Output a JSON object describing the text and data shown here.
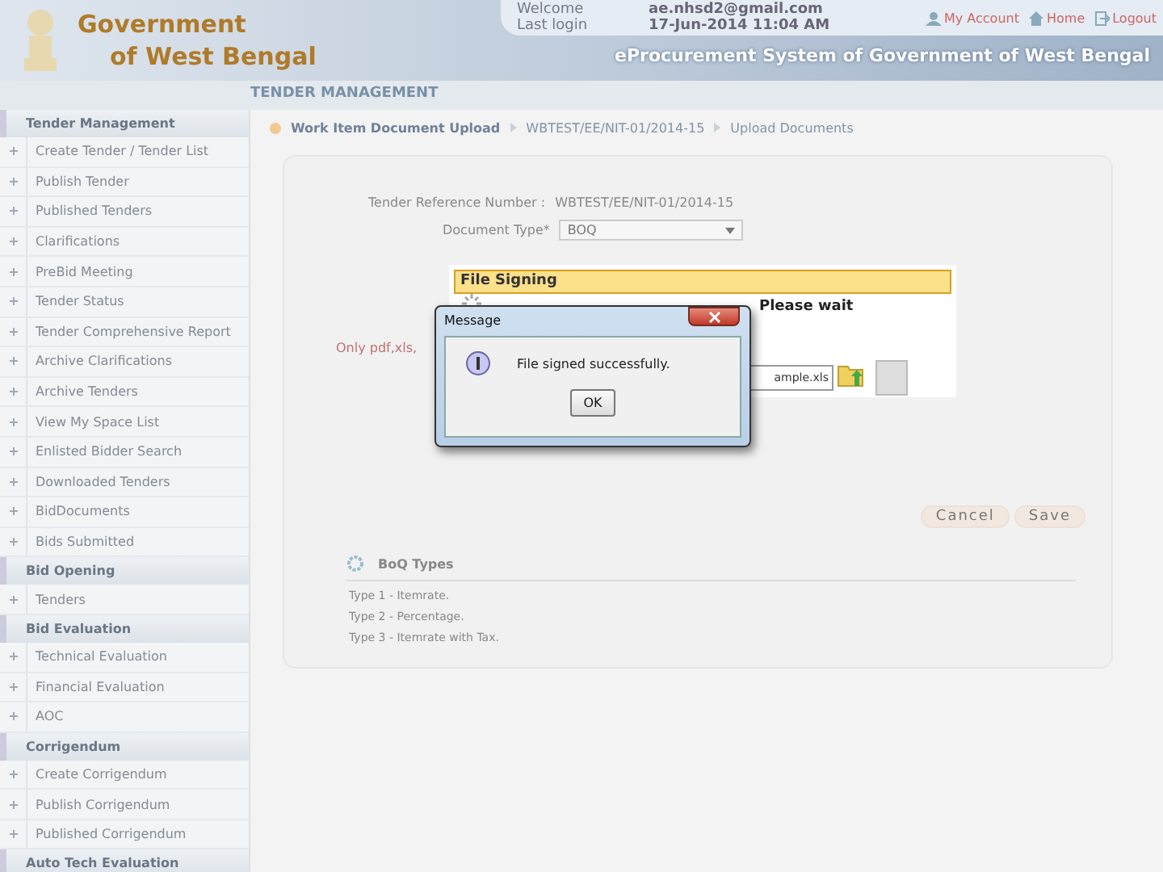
{
  "header": {
    "logo_line_1": "Government",
    "logo_line_2": "of West Bengal",
    "welcome_label": "Welcome",
    "welcome_value": "ae.nhsd2@gmail.com",
    "last_login_label": "Last login",
    "last_login_value": "17-Jun-2014 11:04 AM",
    "links": [
      "My Account",
      "Home",
      "Logout"
    ],
    "system_title": "eProcurement System of Government of West Bengal"
  },
  "section_title": "TENDER MANAGEMENT",
  "sidebar": [
    {
      "heading": "Tender Management",
      "items": [
        "Create Tender / Tender List",
        "Publish Tender",
        "Published Tenders",
        "Clarifications",
        "PreBid Meeting",
        "Tender Status",
        "Tender Comprehensive Report",
        "Archive Clarifications",
        "Archive Tenders",
        "View My Space List",
        "Enlisted Bidder Search",
        "Downloaded Tenders",
        "BidDocuments",
        "Bids Submitted"
      ]
    },
    {
      "heading": "Bid Opening",
      "items": [
        "Tenders"
      ]
    },
    {
      "heading": "Bid Evaluation",
      "items": [
        "Technical Evaluation",
        "Financial Evaluation",
        "AOC"
      ]
    },
    {
      "heading": "Corrigendum",
      "items": [
        "Create Corrigendum",
        "Publish Corrigendum",
        "Published Corrigendum"
      ]
    },
    {
      "heading": "Auto Tech Evaluation"
    }
  ],
  "breadcrumb": [
    "Work Item Document Upload",
    "WBTEST/EE/NIT-01/2014-15",
    "Upload Documents"
  ],
  "form": {
    "ref_label": "Tender Reference Number :",
    "ref_value": "WBTEST/EE/NIT-01/2014-15",
    "doc_type_label": "Document Type*",
    "doc_type_value": "BOQ",
    "note": "Only pdf,xls,",
    "file_value": "ample.xls"
  },
  "file_signing": {
    "title": "File Signing",
    "status": "Please wait"
  },
  "message": {
    "title": "Message",
    "text": "File signed successfully.",
    "button": "OK"
  },
  "buttons": [
    "Cancel",
    "Save"
  ],
  "boq": {
    "title": "BoQ Types",
    "lines": [
      "Type 1 - Itemrate.",
      "Type 2 - Percentage.",
      "Type 3 - Itemrate with Tax."
    ]
  }
}
